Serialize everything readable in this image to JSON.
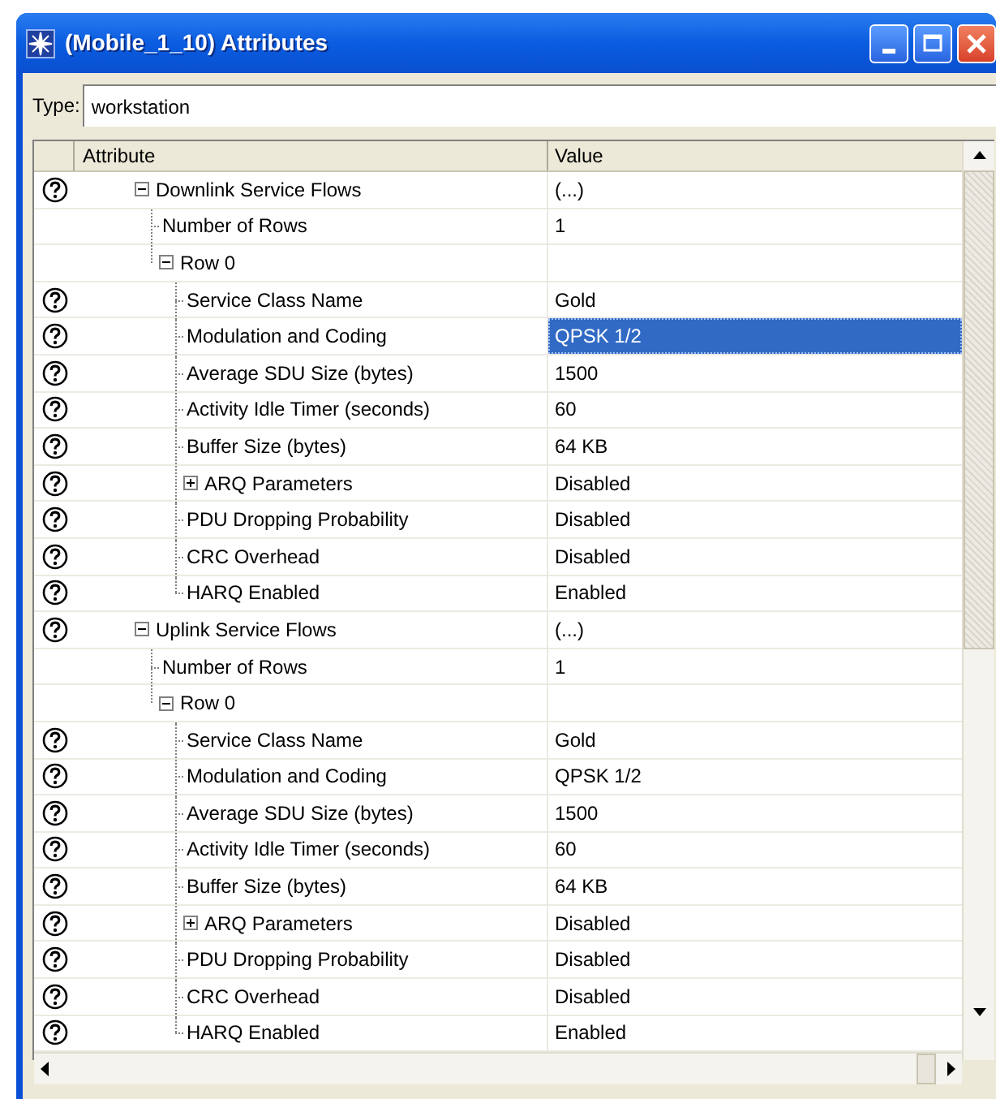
{
  "window": {
    "title": "(Mobile_1_10) Attributes"
  },
  "type_field": {
    "label": "Type:",
    "value": "workstation"
  },
  "grid": {
    "columns": [
      "Attribute",
      "Value"
    ],
    "rows": [
      {
        "label": "Downlink Service Flows",
        "value": "(...)",
        "help": true,
        "expanded": true,
        "selected": false,
        "children": [
          {
            "label": "Number of Rows",
            "value": "1",
            "help": false,
            "selected": false
          },
          {
            "label": "Row 0",
            "help": false,
            "expanded": true,
            "selected": false,
            "children": [
              {
                "label": "Service Class Name",
                "value": "Gold",
                "help": true,
                "selected": false
              },
              {
                "label": "Modulation and Coding",
                "value": "QPSK 1/2",
                "help": true,
                "selected": true
              },
              {
                "label": "Average SDU Size (bytes)",
                "value": "1500",
                "help": true,
                "selected": false
              },
              {
                "label": "Activity Idle Timer (seconds)",
                "value": "60",
                "help": true,
                "selected": false
              },
              {
                "label": "Buffer Size (bytes)",
                "value": "64 KB",
                "help": true,
                "selected": false
              },
              {
                "label": "ARQ Parameters",
                "value": "Disabled",
                "help": true,
                "expanded": false,
                "selected": false
              },
              {
                "label": "PDU Dropping Probability",
                "value": "Disabled",
                "help": true,
                "selected": false
              },
              {
                "label": "CRC Overhead",
                "value": "Disabled",
                "help": true,
                "selected": false
              },
              {
                "label": "HARQ Enabled",
                "value": "Enabled",
                "help": true,
                "selected": false
              }
            ]
          }
        ]
      },
      {
        "label": "Uplink Service Flows",
        "value": "(...)",
        "help": true,
        "expanded": true,
        "selected": false,
        "children": [
          {
            "label": "Number of Rows",
            "value": "1",
            "help": false,
            "selected": false
          },
          {
            "label": "Row 0",
            "help": false,
            "expanded": true,
            "selected": false,
            "children": [
              {
                "label": "Service Class Name",
                "value": "Gold",
                "help": true,
                "selected": false
              },
              {
                "label": "Modulation and Coding",
                "value": "QPSK 1/2",
                "help": true,
                "selected": false
              },
              {
                "label": "Average SDU Size (bytes)",
                "value": "1500",
                "help": true,
                "selected": false
              },
              {
                "label": "Activity Idle Timer (seconds)",
                "value": "60",
                "help": true,
                "selected": false
              },
              {
                "label": "Buffer Size (bytes)",
                "value": "64 KB",
                "help": true,
                "selected": false
              },
              {
                "label": "ARQ Parameters",
                "value": "Disabled",
                "help": true,
                "expanded": false,
                "selected": false
              },
              {
                "label": "PDU Dropping Probability",
                "value": "Disabled",
                "help": true,
                "selected": false
              },
              {
                "label": "CRC Overhead",
                "value": "Disabled",
                "help": true,
                "selected": false
              },
              {
                "label": "HARQ Enabled",
                "value": "Enabled",
                "help": true,
                "selected": false
              }
            ]
          }
        ]
      }
    ]
  }
}
